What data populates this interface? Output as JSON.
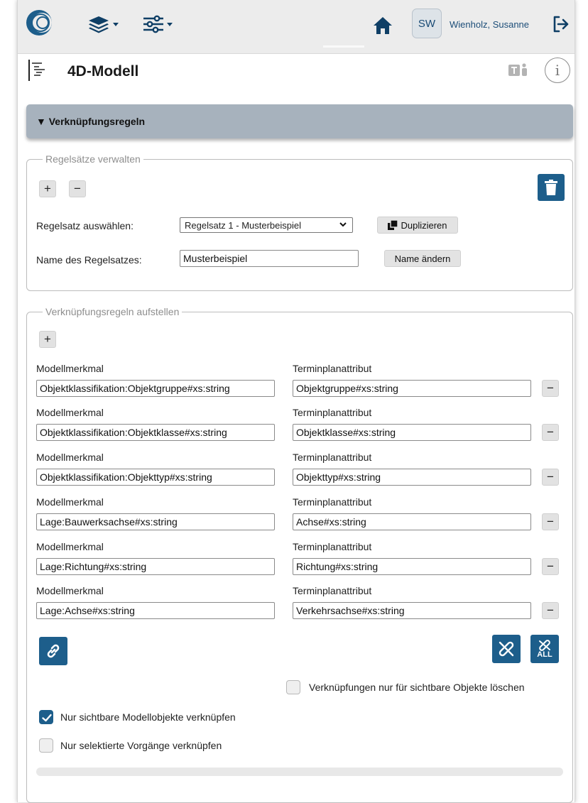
{
  "header": {
    "user_initials": "SW",
    "user_name": "Wienholz, Susanne"
  },
  "icons": {
    "logo": "app-logo",
    "layers": "layers-icon",
    "settings": "sliders-icon",
    "home": "home-icon",
    "logout": "logout-icon",
    "tree": "tree-structure-icon",
    "teams": "teams-icon",
    "info": "info-icon",
    "trash": "trash-icon",
    "link": "link-icon",
    "unlink": "unlink-icon",
    "unlink_all": "unlink-all-icon"
  },
  "colors": {
    "accent": "#1d5e8b",
    "section_header": "#a7b2bd",
    "topbar": "#ececec"
  },
  "page": {
    "title": "4D-Modell",
    "info_glyph": "i"
  },
  "section": {
    "label": "▼ Verknüpfungsregeln"
  },
  "rulesets": {
    "legend": "Regelsätze verwalten",
    "add": "+",
    "remove": "−",
    "select_label": "Regelsatz auswählen:",
    "selected": "Regelsatz 1 - Musterbeispiel",
    "duplicate_label": "Duplizieren",
    "name_label": "Name des Regelsatzes:",
    "name_value": "Musterbeispiel",
    "rename_label": "Name ändern"
  },
  "rules_setup": {
    "legend": "Verknüpfungsregeln aufstellen",
    "add": "+",
    "remove": "−",
    "model_header": "Modellmerkmal",
    "schedule_header": "Terminplanattribut",
    "rules": [
      {
        "model": "Objektklassifikation:Objektgruppe#xs:string",
        "schedule": "Objektgruppe#xs:string"
      },
      {
        "model": "Objektklassifikation:Objektklasse#xs:string",
        "schedule": "Objektklasse#xs:string"
      },
      {
        "model": "Objektklassifikation:Objekttyp#xs:string",
        "schedule": "Objekttyp#xs:string"
      },
      {
        "model": "Lage:Bauwerksachse#xs:string",
        "schedule": "Achse#xs:string"
      },
      {
        "model": "Lage:Richtung#xs:string",
        "schedule": "Richtung#xs:string"
      },
      {
        "model": "Lage:Achse#xs:string",
        "schedule": "Verkehrsachse#xs:string"
      }
    ],
    "unlink_all_label": "ALL",
    "delete_visible_only": {
      "label": "Verknüpfungen nur für sichtbare Objekte löschen",
      "checked": false
    },
    "link_visible_only": {
      "label": "Nur sichtbare Modellobjekte verknüpfen",
      "checked": true
    },
    "link_selected_only": {
      "label": "Nur selektierte Vorgänge verknüpfen",
      "checked": false
    }
  }
}
